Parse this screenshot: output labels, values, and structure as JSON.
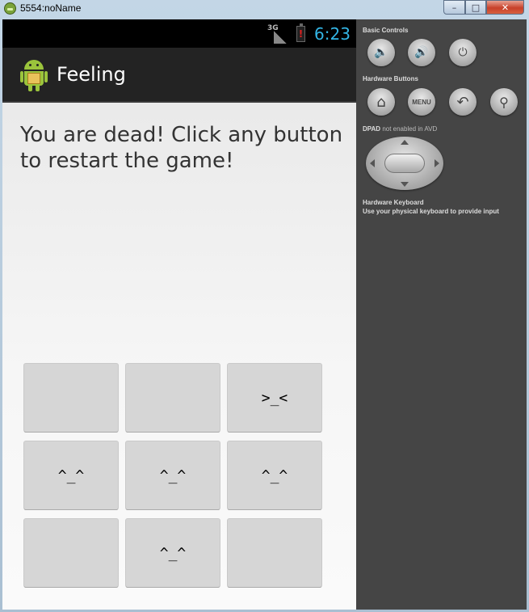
{
  "window": {
    "title": "5554:noName",
    "minimize": "–",
    "maximize": "□",
    "close": "✕"
  },
  "statusbar": {
    "network": "3G",
    "battery_alert": "!",
    "time": "6:23",
    "time_color": "#33b5e5"
  },
  "actionbar": {
    "app_title": "Feeling",
    "icon": "android-robot-icon"
  },
  "main": {
    "message": "You are dead! Click any button to restart the game!",
    "cells": [
      {
        "label": ""
      },
      {
        "label": ""
      },
      {
        "label": ">_<"
      },
      {
        "label": "^_^"
      },
      {
        "label": "^_^"
      },
      {
        "label": "^_^"
      },
      {
        "label": ""
      },
      {
        "label": "^_^"
      },
      {
        "label": ""
      }
    ]
  },
  "panel": {
    "basic_controls_label": "Basic Controls",
    "hardware_buttons_label": "Hardware Buttons",
    "dpad_label": "DPAD",
    "dpad_note": "not enabled in AVD",
    "keyboard_label": "Hardware Keyboard",
    "keyboard_note": "Use your physical keyboard to provide input",
    "menu_label": "MENU",
    "volume_down_glyph": "🔈",
    "volume_up_glyph": "🔊",
    "power_glyph": "⏻",
    "home_glyph": "⌂",
    "back_glyph": "↶",
    "search_glyph": "⚲"
  }
}
